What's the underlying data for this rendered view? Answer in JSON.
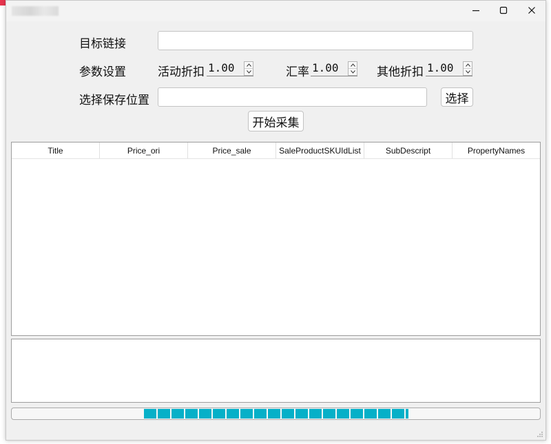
{
  "window": {
    "controls": {
      "minimize": "minimize-icon",
      "maximize": "maximize-icon",
      "close": "close-icon"
    }
  },
  "form": {
    "target_link_label": "目标链接",
    "target_link_value": "",
    "params_label": "参数设置",
    "activity_discount_label": "活动折扣",
    "activity_discount_value": "1.00",
    "exchange_rate_label": "汇率",
    "exchange_rate_value": "1.00",
    "other_discount_label": "其他折扣",
    "other_discount_value": "1.00",
    "save_location_label": "选择保存位置",
    "save_location_value": "",
    "choose_button": "选择",
    "start_button": "开始采集"
  },
  "table": {
    "columns": [
      "Title",
      "Price_ori",
      "Price_sale",
      "SaleProductSKUIdList",
      "SubDescript",
      "PropertyNames"
    ],
    "rows": []
  },
  "log": {
    "text": ""
  },
  "progress": {
    "fraction": 0.5
  },
  "colors": {
    "progress_fill": "#06b0c8",
    "window_bg": "#f0f0f0"
  }
}
